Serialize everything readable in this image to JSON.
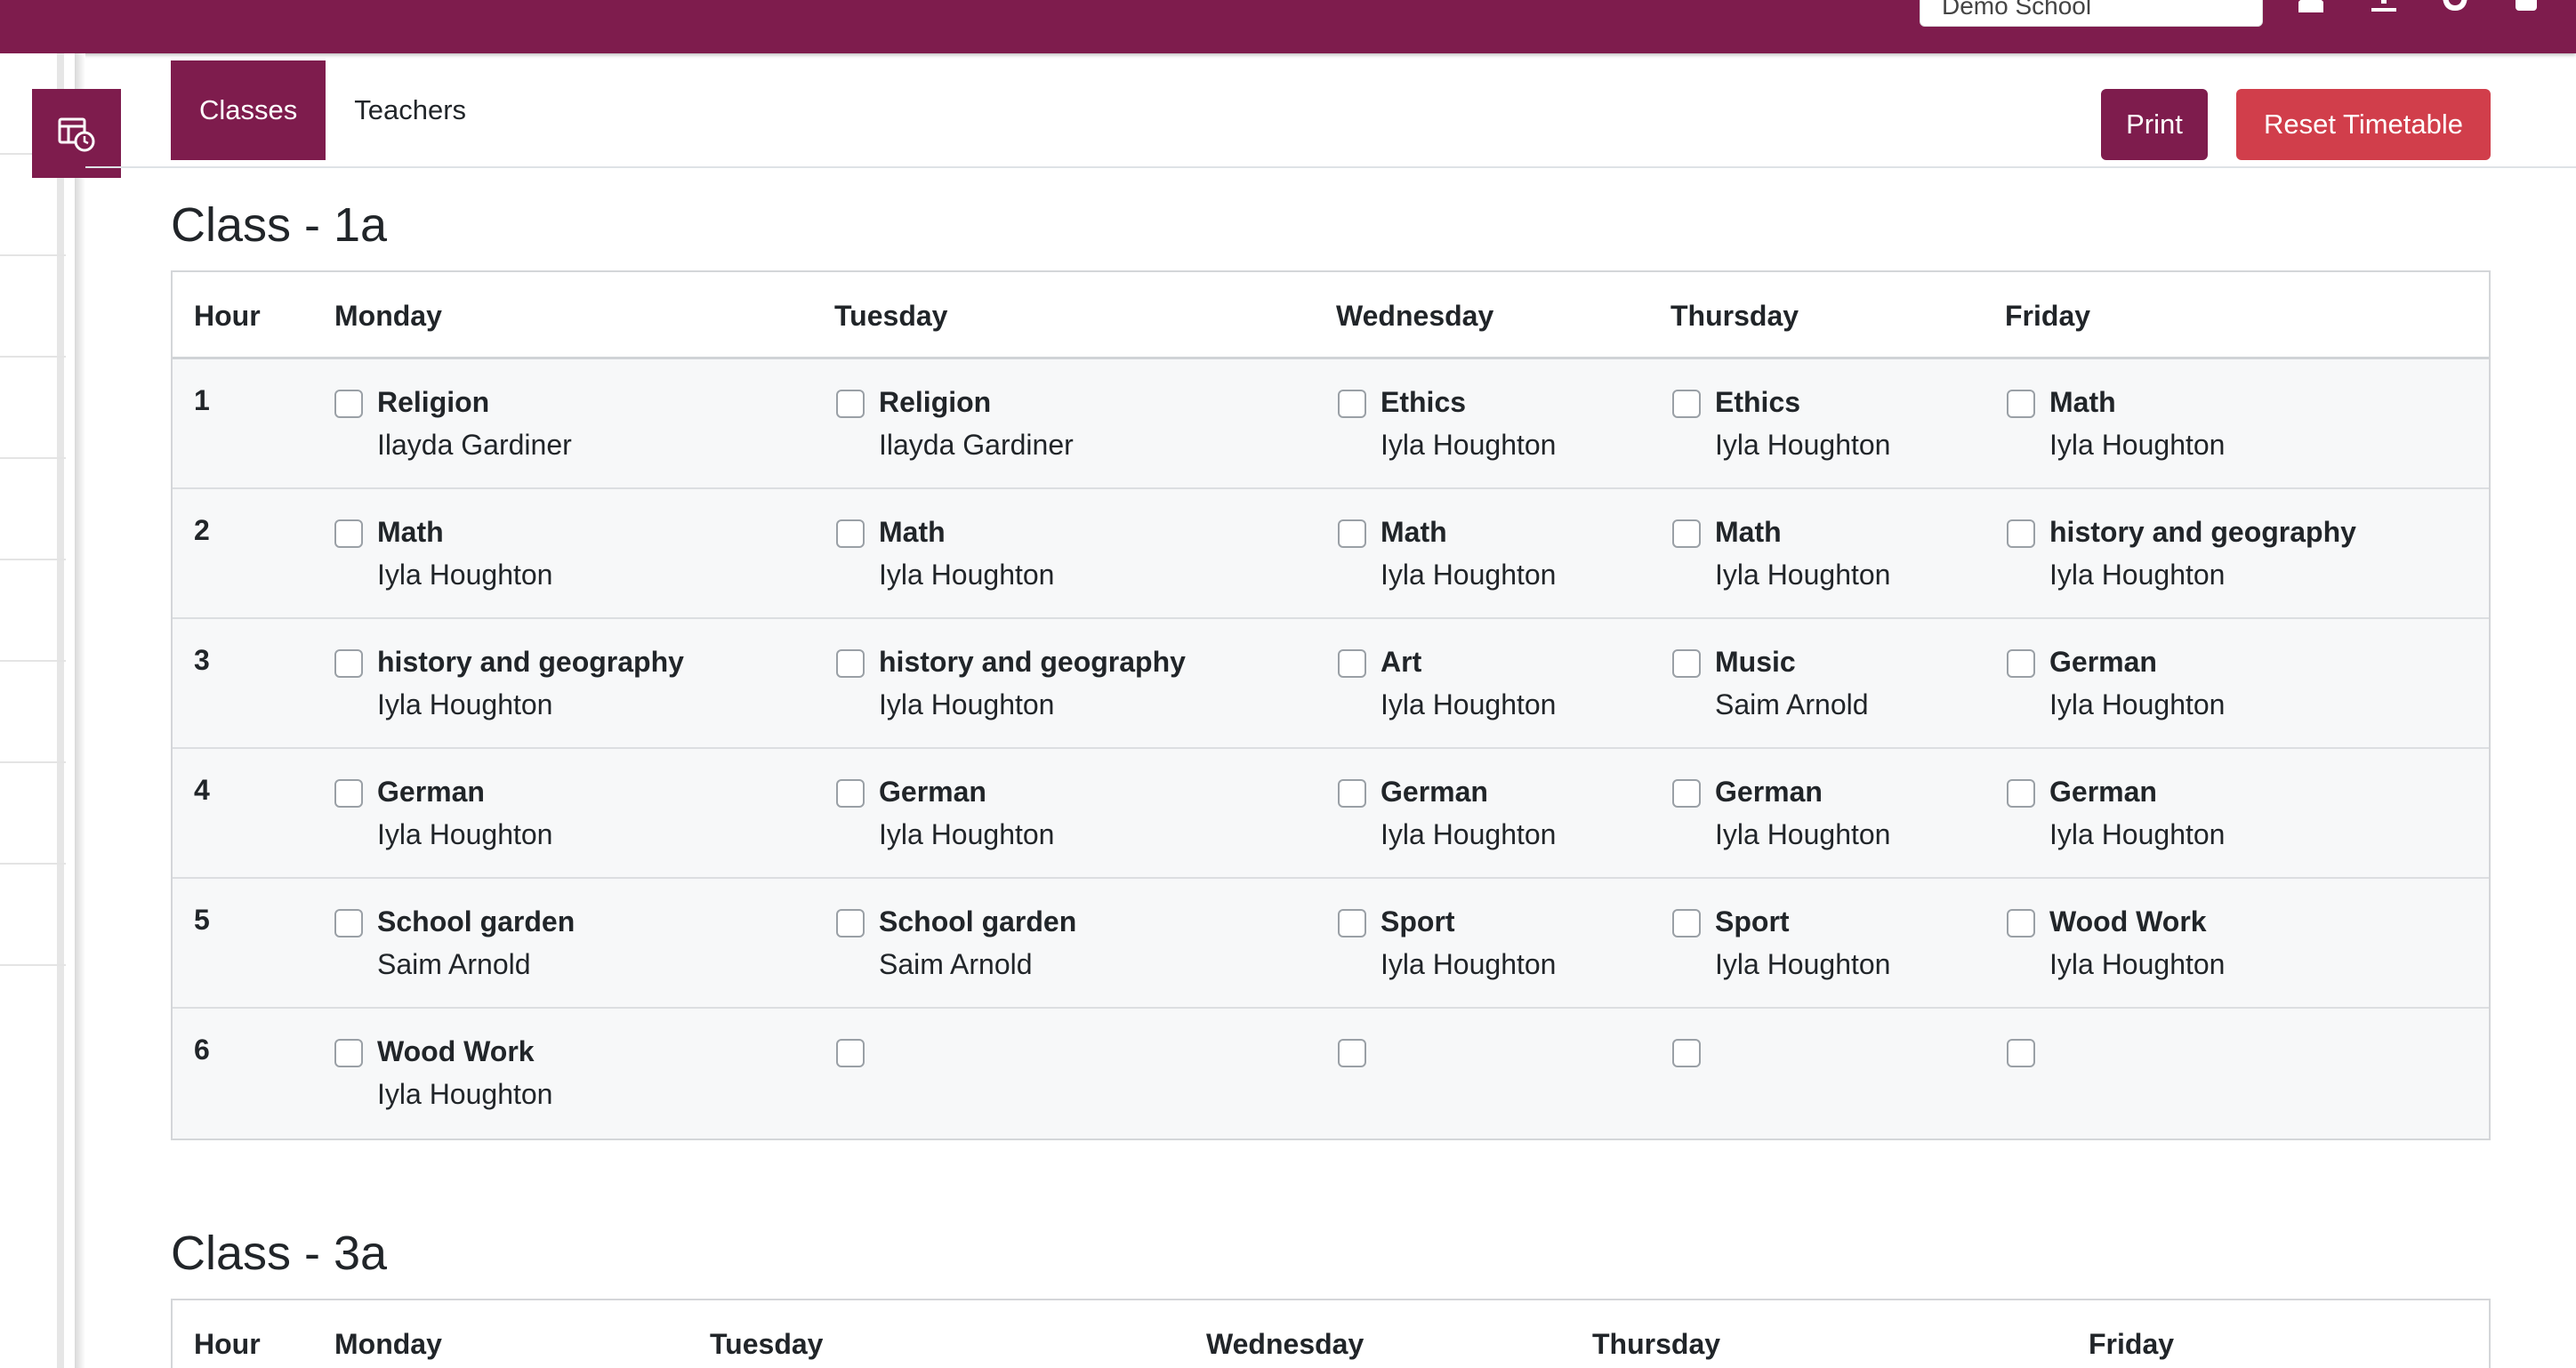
{
  "topbar": {
    "school_selector_value": "Demo School",
    "icons": [
      "user-icon",
      "download-icon",
      "github-icon",
      "settings-icon"
    ],
    "color": "#7e1c4d"
  },
  "rail": {
    "active_icon": "timetable-icon"
  },
  "tabs": [
    {
      "label": "Classes",
      "active": true
    },
    {
      "label": "Teachers",
      "active": false
    }
  ],
  "actions": {
    "print_label": "Print",
    "reset_label": "Reset Timetable"
  },
  "classes": [
    {
      "title": "Class - 1a",
      "headers": [
        "Hour",
        "Monday",
        "Tuesday",
        "Wednesday",
        "Thursday",
        "Friday"
      ],
      "rows": [
        {
          "hour": "1",
          "cells": [
            {
              "subject": "Religion",
              "teacher": "Ilayda Gardiner"
            },
            {
              "subject": "Religion",
              "teacher": "Ilayda Gardiner"
            },
            {
              "subject": "Ethics",
              "teacher": "Iyla Houghton"
            },
            {
              "subject": "Ethics",
              "teacher": "Iyla Houghton"
            },
            {
              "subject": "Math",
              "teacher": "Iyla Houghton"
            }
          ]
        },
        {
          "hour": "2",
          "cells": [
            {
              "subject": "Math",
              "teacher": "Iyla Houghton"
            },
            {
              "subject": "Math",
              "teacher": "Iyla Houghton"
            },
            {
              "subject": "Math",
              "teacher": "Iyla Houghton"
            },
            {
              "subject": "Math",
              "teacher": "Iyla Houghton"
            },
            {
              "subject": "history and geography",
              "teacher": "Iyla Houghton"
            }
          ]
        },
        {
          "hour": "3",
          "cells": [
            {
              "subject": "history and geography",
              "teacher": "Iyla Houghton"
            },
            {
              "subject": "history and geography",
              "teacher": "Iyla Houghton"
            },
            {
              "subject": "Art",
              "teacher": "Iyla Houghton"
            },
            {
              "subject": "Music",
              "teacher": "Saim Arnold"
            },
            {
              "subject": "German",
              "teacher": "Iyla Houghton"
            }
          ]
        },
        {
          "hour": "4",
          "cells": [
            {
              "subject": "German",
              "teacher": "Iyla Houghton"
            },
            {
              "subject": "German",
              "teacher": "Iyla Houghton"
            },
            {
              "subject": "German",
              "teacher": "Iyla Houghton"
            },
            {
              "subject": "German",
              "teacher": "Iyla Houghton"
            },
            {
              "subject": "German",
              "teacher": "Iyla Houghton"
            }
          ]
        },
        {
          "hour": "5",
          "cells": [
            {
              "subject": "School garden",
              "teacher": "Saim Arnold"
            },
            {
              "subject": "School garden",
              "teacher": "Saim Arnold"
            },
            {
              "subject": "Sport",
              "teacher": "Iyla Houghton"
            },
            {
              "subject": "Sport",
              "teacher": "Iyla Houghton"
            },
            {
              "subject": "Wood Work",
              "teacher": "Iyla Houghton"
            }
          ]
        },
        {
          "hour": "6",
          "cells": [
            {
              "subject": "Wood Work",
              "teacher": "Iyla Houghton"
            },
            {
              "subject": "",
              "teacher": ""
            },
            {
              "subject": "",
              "teacher": ""
            },
            {
              "subject": "",
              "teacher": ""
            },
            {
              "subject": "",
              "teacher": ""
            }
          ]
        }
      ]
    },
    {
      "title": "Class - 3a",
      "headers": [
        "Hour",
        "Monday",
        "Tuesday",
        "Wednesday",
        "Thursday",
        "Friday"
      ],
      "rows": []
    }
  ]
}
